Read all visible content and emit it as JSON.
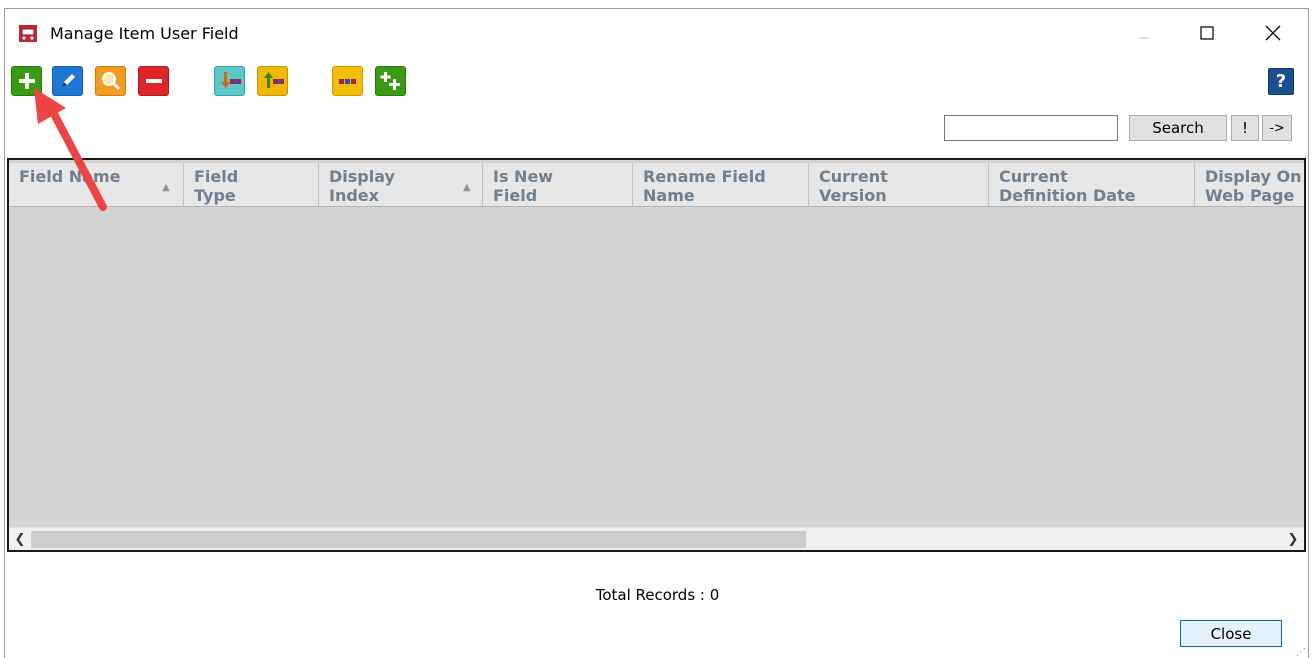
{
  "window": {
    "title": "Manage Item User Field"
  },
  "toolbar": {
    "buttons": [
      {
        "name": "add",
        "icon": "plus-icon",
        "color": "#3a9a12"
      },
      {
        "name": "edit",
        "icon": "pencil-icon",
        "color": "#1e78d8"
      },
      {
        "name": "view",
        "icon": "magnifier-icon",
        "color": "#f39c1f"
      },
      {
        "name": "delete",
        "icon": "minus-icon",
        "color": "#e0242a"
      },
      {
        "name": "move-down",
        "icon": "move-down-icon",
        "color": "#5ac8c8"
      },
      {
        "name": "move-up",
        "icon": "move-up-icon",
        "color": "#f0b800"
      },
      {
        "name": "reorder",
        "icon": "reorder-icon",
        "color": "#f0c000"
      },
      {
        "name": "add-multiple",
        "icon": "plus-plus-icon",
        "color": "#3a9a12"
      }
    ],
    "help_label": "?"
  },
  "search": {
    "value": "",
    "button_label": "Search",
    "bang_label": "!",
    "next_label": "->"
  },
  "grid": {
    "columns": [
      {
        "label": "Field Name",
        "sortable": true
      },
      {
        "label": "Field Type",
        "sortable": false
      },
      {
        "label": "Display Index",
        "sortable": true
      },
      {
        "label": "Is New Field",
        "sortable": false
      },
      {
        "label": "Rename Field Name",
        "sortable": false
      },
      {
        "label": "Current Version",
        "sortable": false
      },
      {
        "label": "Current Definition Date",
        "sortable": false
      },
      {
        "label": "Display On Web Page",
        "sortable": false
      }
    ],
    "rows": []
  },
  "footer": {
    "total_label": "Total Records : 0",
    "close_label": "Close"
  },
  "colors": {
    "header_text": "#6f8090",
    "grid_bg": "#d3d3d3",
    "annotation_arrow": "#ee4444"
  }
}
